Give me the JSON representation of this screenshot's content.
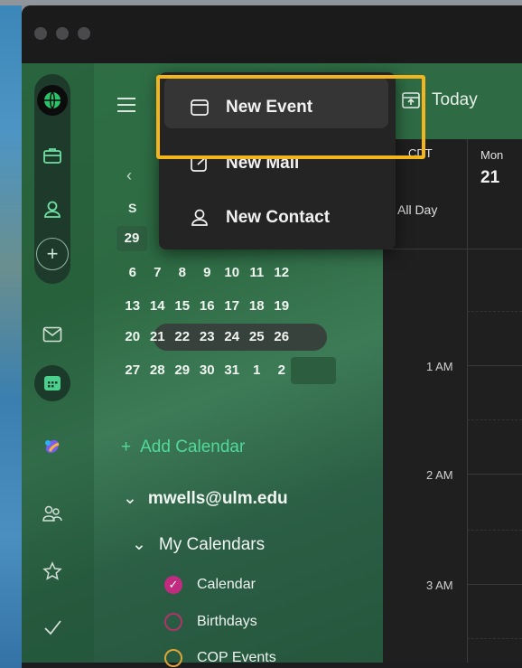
{
  "menu": {
    "items": [
      {
        "label": "New Event",
        "icon": "calendar-square-icon"
      },
      {
        "label": "New Mail",
        "icon": "compose-icon"
      },
      {
        "label": "New Contact",
        "icon": "person-icon"
      }
    ]
  },
  "toolbar": {
    "today_label": "Today"
  },
  "mini_calendar": {
    "weekday_header": "S",
    "prev_row_first": "29",
    "weeks": [
      [
        "6",
        "7",
        "8",
        "9",
        "10",
        "11",
        "12"
      ],
      [
        "13",
        "14",
        "15",
        "16",
        "17",
        "18",
        "19"
      ],
      [
        "20",
        "21",
        "22",
        "23",
        "24",
        "25",
        "26"
      ],
      [
        "27",
        "28",
        "29",
        "30",
        "31",
        "1",
        "2"
      ]
    ]
  },
  "sidebar": {
    "add_calendar": "Add Calendar",
    "account": "mwells@ulm.edu",
    "group": "My Calendars",
    "calendars": [
      {
        "name": "Calendar",
        "color": "#c02a7f",
        "checked": true
      },
      {
        "name": "Birthdays",
        "color": "#b0346a",
        "checked": false
      },
      {
        "name": "COP Events",
        "color": "#e0a43a",
        "checked": false
      }
    ]
  },
  "calendar_view": {
    "timezone": "CDT",
    "all_day": "All Day",
    "day_name": "Mon",
    "day_number": "21",
    "hours": [
      "1 AM",
      "2 AM",
      "3 AM"
    ]
  }
}
